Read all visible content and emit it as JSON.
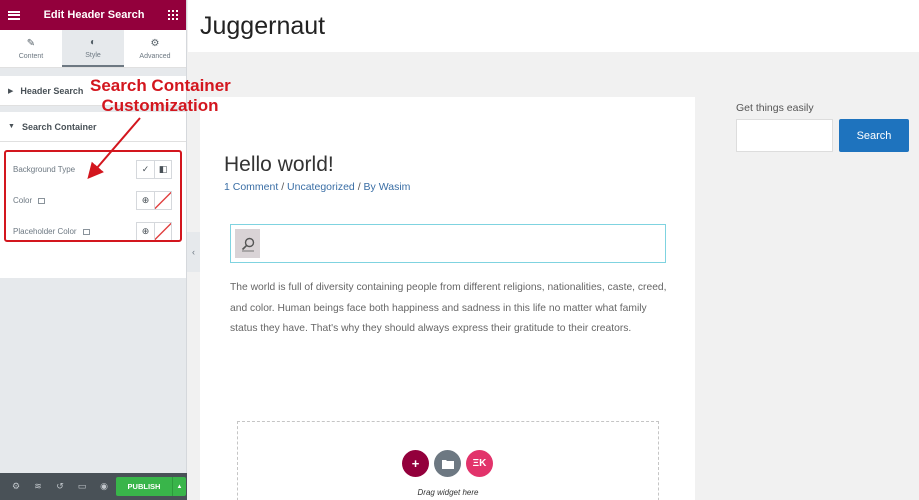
{
  "panel": {
    "header_title": "Edit Header Search",
    "tabs": [
      {
        "label": "Content",
        "icon": "pencil-icon"
      },
      {
        "label": "Style",
        "icon": "half-circle-icon"
      },
      {
        "label": "Advanced",
        "icon": "gear-icon"
      }
    ],
    "active_tab": "Style",
    "sections": {
      "header_search": "Header Search",
      "search_container": "Search Container"
    },
    "controls": {
      "background_type": "Background Type",
      "color": "Color",
      "placeholder_color": "Placeholder Color"
    },
    "footer": {
      "publish_label": "PUBLISH"
    }
  },
  "annotation": {
    "line1": "Search Container",
    "line2": "Customization",
    "color": "#d3161e"
  },
  "site": {
    "title": "Juggernaut"
  },
  "post": {
    "title": "Hello world!",
    "meta": {
      "comments": "1 Comment",
      "category": "Uncategorized",
      "by": "By",
      "author": "Wasim",
      "separator": "/"
    },
    "text": "The world is full of diversity containing people from different religions, nationalities, caste, creed, and color. Human beings face both happiness and sadness in this life no matter what family status they have. That's why they should always express their gratitude to their creators."
  },
  "drop_zone": {
    "text": "Drag widget here"
  },
  "sidebar": {
    "widget_title": "Get things easily",
    "search_button": "Search"
  },
  "colors": {
    "panel_header": "#93003c",
    "publish": "#39b54a",
    "link": "#3a6ea5",
    "search_button": "#1e73be"
  }
}
